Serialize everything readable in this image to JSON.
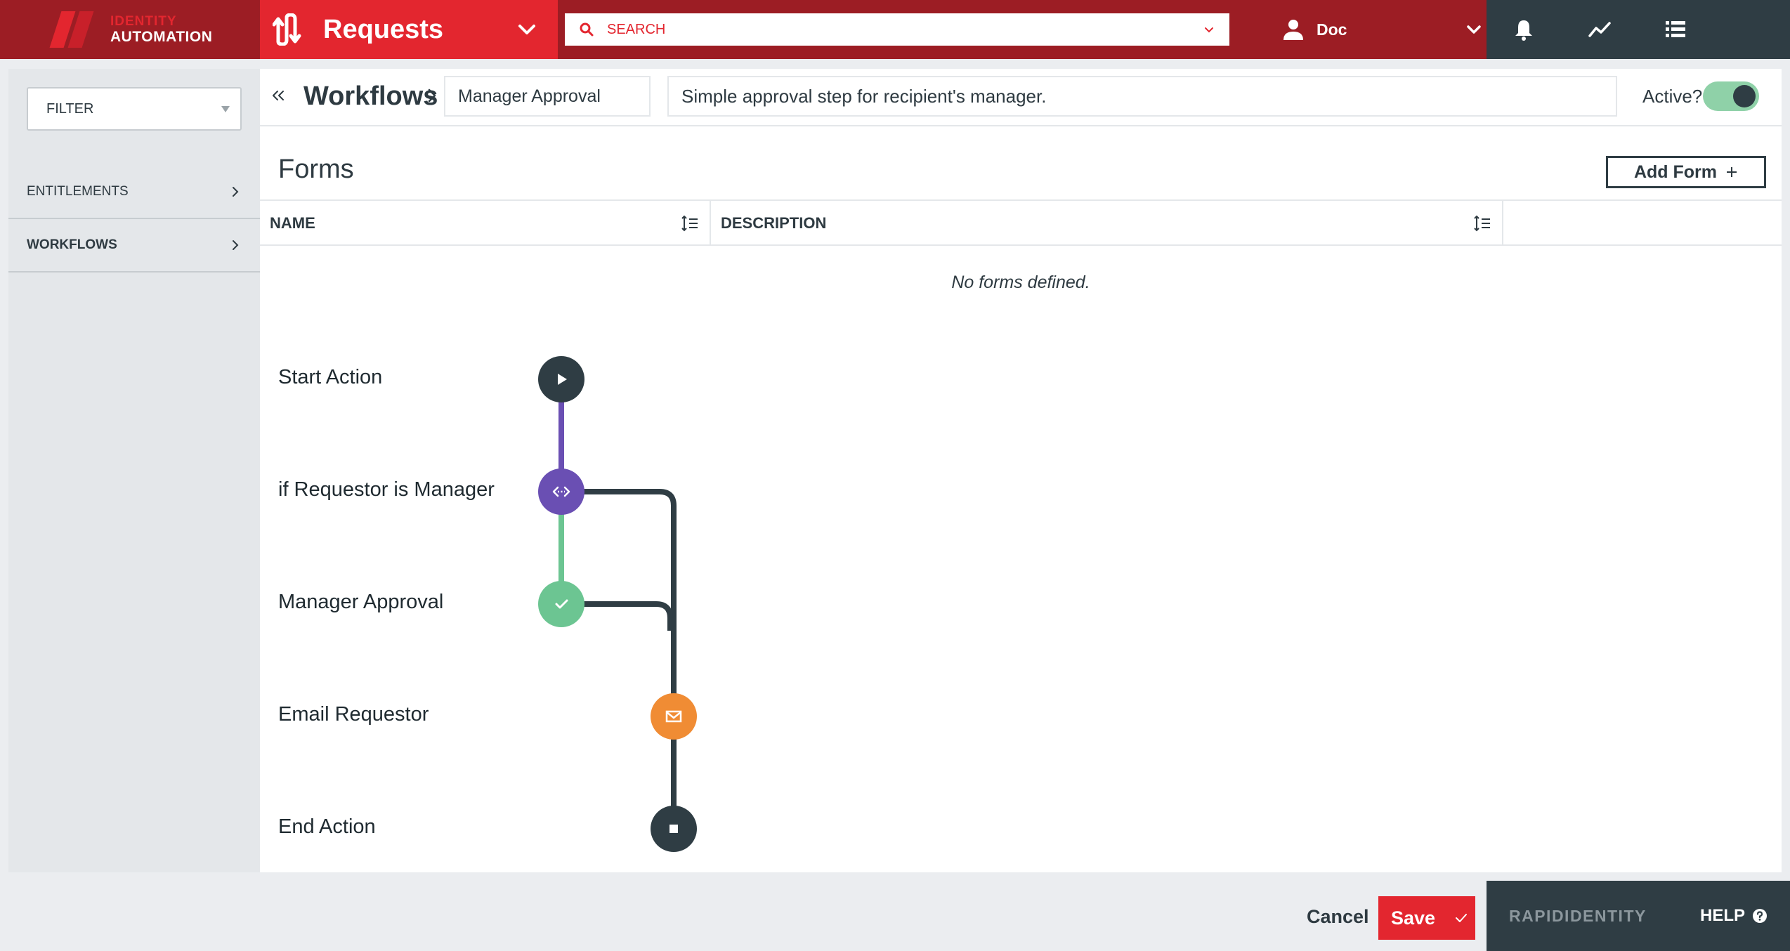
{
  "brand": {
    "logo_line1": "IDENTITY",
    "logo_line2": "AUTOMATION",
    "product": "RAPIDIDENTITY"
  },
  "module": {
    "title": "Requests"
  },
  "search": {
    "placeholder": "SEARCH"
  },
  "user": {
    "name": "Doc"
  },
  "sidebar": {
    "filter_label": "FILTER",
    "items": [
      {
        "label": "ENTITLEMENTS",
        "active": false
      },
      {
        "label": "WORKFLOWS",
        "active": true
      }
    ]
  },
  "breadcrumb": {
    "section": "Workflows",
    "workflow_name": "Manager Approval"
  },
  "workflow": {
    "description": "Simple approval step for recipient's manager.",
    "active_label": "Active?",
    "active": true
  },
  "forms": {
    "title": "Forms",
    "add_label": "Add Form",
    "columns": [
      "NAME",
      "DESCRIPTION"
    ],
    "empty_text": "No forms defined."
  },
  "steps": [
    {
      "label": "Start Action",
      "icon": "play-icon",
      "color": "#2f3d44"
    },
    {
      "label": "if Requestor is Manager",
      "icon": "branch-icon",
      "color": "#6a4fb3"
    },
    {
      "label": "Manager Approval",
      "icon": "check-icon",
      "color": "#6cc592"
    },
    {
      "label": "Email Requestor",
      "icon": "envelope-icon",
      "color": "#f08c34"
    },
    {
      "label": "End Action",
      "icon": "stop-icon",
      "color": "#2f3d44"
    }
  ],
  "footer": {
    "cancel_label": "Cancel",
    "save_label": "Save",
    "help_label": "HELP"
  },
  "colors": {
    "primary_red": "#e3262f",
    "dark_red": "#9c1d24",
    "slate": "#2f3d44",
    "toggle_on": "#8fd1a8"
  }
}
